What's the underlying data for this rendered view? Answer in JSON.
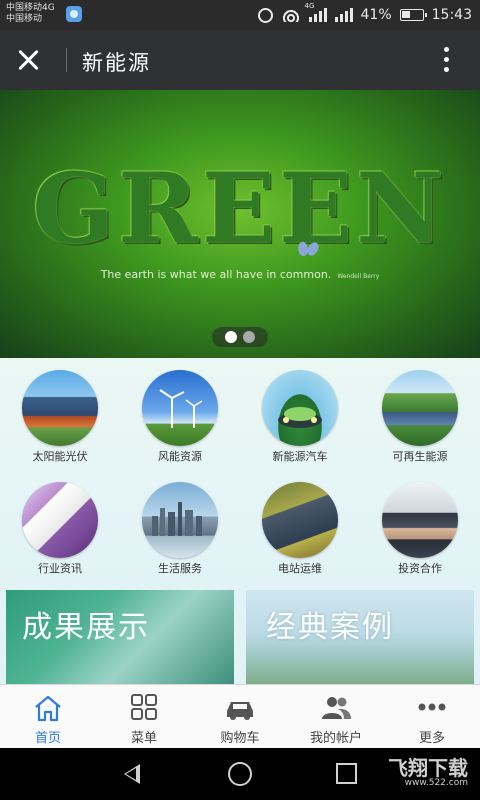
{
  "status_bar": {
    "carrier_line1": "中国移动4G",
    "carrier_line2": "中国移动",
    "network_tag": "4G",
    "battery_text": "41%",
    "battery_level": 0.41,
    "time": "15:43"
  },
  "title_bar": {
    "title": "新能源"
  },
  "banner": {
    "headline": "GREEN",
    "quote": "The earth is what we all have in common.",
    "author": "Wendell Berry",
    "slides": 2,
    "active_slide": 1
  },
  "categories": [
    {
      "label": "太阳能光伏",
      "icon": "solar-panel-icon"
    },
    {
      "label": "风能资源",
      "icon": "wind-turbine-icon"
    },
    {
      "label": "新能源汽车",
      "icon": "electric-car-icon"
    },
    {
      "label": "可再生能源",
      "icon": "renewable-field-icon"
    },
    {
      "label": "行业资讯",
      "icon": "newspaper-icon"
    },
    {
      "label": "生活服务",
      "icon": "city-skyline-icon"
    },
    {
      "label": "电站运维",
      "icon": "power-station-icon"
    },
    {
      "label": "投资合作",
      "icon": "handshake-icon"
    }
  ],
  "showcase": {
    "left_title": "成果展示",
    "right_title": "经典案例"
  },
  "tabs": [
    {
      "label": "首页",
      "icon": "home-icon",
      "active": true
    },
    {
      "label": "菜单",
      "icon": "menu-grid-icon",
      "active": false
    },
    {
      "label": "购物车",
      "icon": "car-icon",
      "active": false
    },
    {
      "label": "我的帐户",
      "icon": "users-icon",
      "active": false
    },
    {
      "label": "更多",
      "icon": "more-dots-icon",
      "active": false
    }
  ],
  "watermark": {
    "main": "飞翔下载",
    "sub": "www.522.com"
  },
  "colors": {
    "accent": "#2e7dd7",
    "title_bar": "#2f3133",
    "grid_bg": "#e2f3f7"
  }
}
